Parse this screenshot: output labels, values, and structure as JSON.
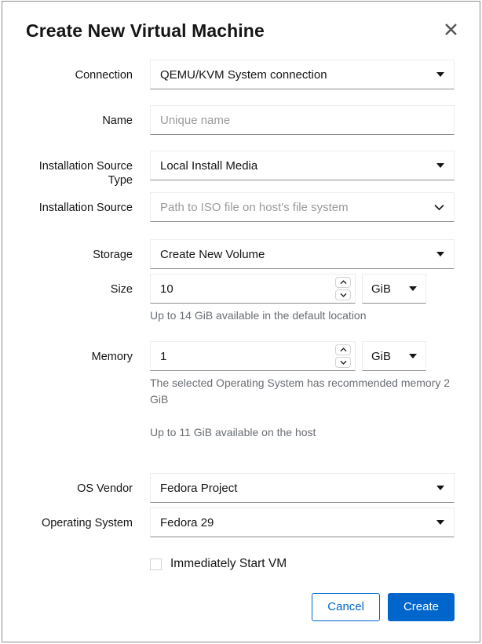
{
  "dialog": {
    "title": "Create New Virtual Machine",
    "close_icon": "close-icon"
  },
  "form": {
    "connection": {
      "label": "Connection",
      "value": "QEMU/KVM System connection",
      "icon": "caret-down-icon"
    },
    "name": {
      "label": "Name",
      "value": "",
      "placeholder": "Unique name"
    },
    "installation_source_type": {
      "label": "Installation Source Type",
      "value": "Local Install Media",
      "icon": "caret-down-icon"
    },
    "installation_source": {
      "label": "Installation Source",
      "value": "",
      "placeholder": "Path to ISO file on host's file system",
      "icon": "chevron-down-icon"
    },
    "storage": {
      "label": "Storage",
      "value": "Create New Volume",
      "icon": "caret-down-icon"
    },
    "size": {
      "label": "Size",
      "value": "10",
      "unit": "GiB",
      "helper": "Up to 14 GiB available in the default location",
      "spinner_up_icon": "chevron-up-icon",
      "spinner_down_icon": "chevron-down-icon"
    },
    "memory": {
      "label": "Memory",
      "value": "1",
      "unit": "GiB",
      "helper_recommended": "The selected Operating System has recommended memory 2 GiB",
      "helper_available": "Up to 11 GiB available on the host",
      "spinner_up_icon": "chevron-up-icon",
      "spinner_down_icon": "chevron-down-icon"
    },
    "os_vendor": {
      "label": "OS Vendor",
      "value": "Fedora Project",
      "icon": "caret-down-icon"
    },
    "operating_system": {
      "label": "Operating System",
      "value": "Fedora 29",
      "icon": "caret-down-icon"
    },
    "immediately_start_vm": {
      "label": "Immediately Start VM",
      "checked": false
    }
  },
  "footer": {
    "cancel_label": "Cancel",
    "create_label": "Create"
  },
  "colors": {
    "primary": "#0066cc",
    "text": "#151515",
    "muted": "#6a6e73",
    "placeholder": "#9a9a9a",
    "border": "#ededed",
    "border_bottom": "#8a8d90"
  }
}
